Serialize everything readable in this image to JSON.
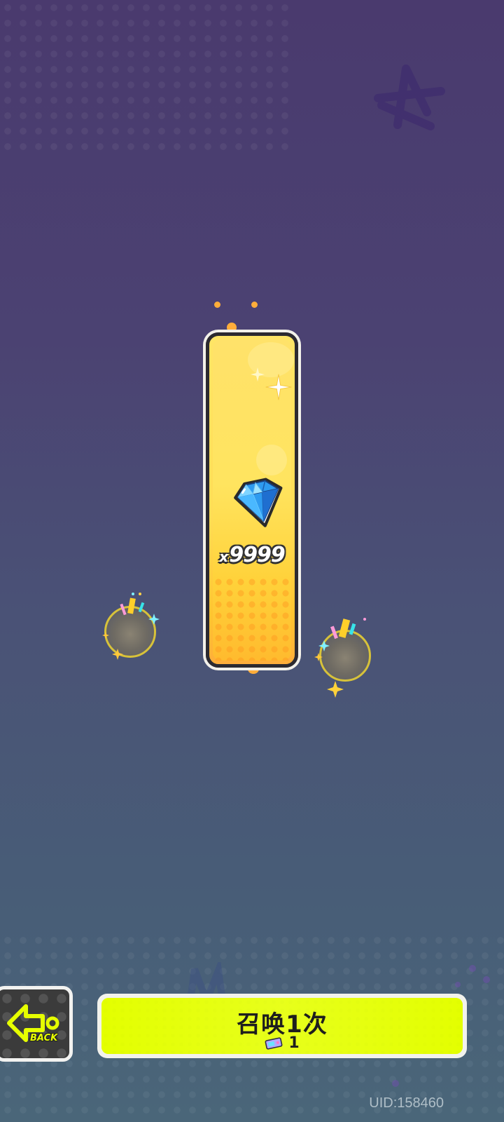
{
  "reward": {
    "item_icon": "blue-diamond-gem-icon",
    "multiplier_prefix": "x",
    "quantity": "9999"
  },
  "controls": {
    "back_label": "BACK",
    "back_icon": "arrow-left-icon",
    "summon_label": "召唤1次",
    "summon_cost_icon": "summon-ticket-icon",
    "summon_cost": "1"
  },
  "footer": {
    "uid": "UID:158460"
  },
  "colors": {
    "card_yellow": "#ffe26a",
    "summon_button": "#e5ff00",
    "back_accent": "#e6ff00",
    "background_top": "#4a3a6e",
    "background_bottom": "#4a6679"
  }
}
